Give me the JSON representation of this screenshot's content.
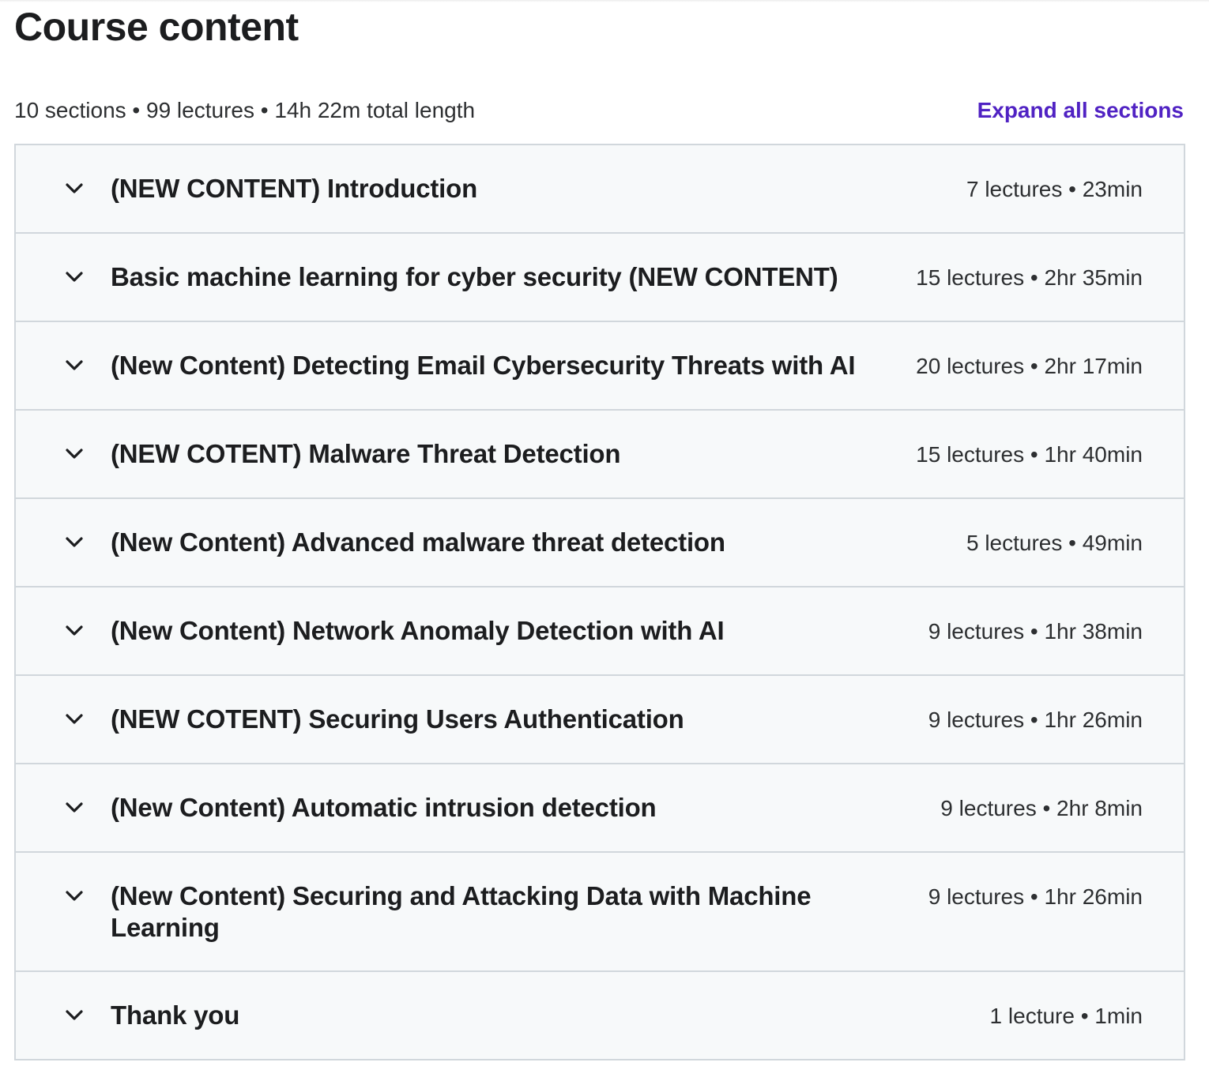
{
  "page": {
    "title": "Course content"
  },
  "summary": {
    "text": "10 sections • 99 lectures • 14h 22m total length",
    "expand_label": "Expand all sections"
  },
  "sections": [
    {
      "title": "(NEW CONTENT) Introduction",
      "meta": "7 lectures • 23min"
    },
    {
      "title": "Basic machine learning for cyber security (NEW CONTENT)",
      "meta": "15 lectures • 2hr 35min"
    },
    {
      "title": "(New Content) Detecting Email Cybersecurity Threats with AI",
      "meta": "20 lectures • 2hr 17min"
    },
    {
      "title": "(NEW COTENT) Malware Threat Detection",
      "meta": "15 lectures • 1hr 40min"
    },
    {
      "title": "(New Content) Advanced malware threat detection",
      "meta": "5 lectures • 49min"
    },
    {
      "title": "(New Content) Network Anomaly Detection with AI",
      "meta": "9 lectures • 1hr 38min"
    },
    {
      "title": "(NEW COTENT) Securing Users Authentication",
      "meta": "9 lectures • 1hr 26min"
    },
    {
      "title": "(New Content) Automatic intrusion detection",
      "meta": "9 lectures • 2hr 8min"
    },
    {
      "title": "(New Content) Securing and Attacking Data with Machine Learning",
      "meta": "9 lectures • 1hr 26min"
    },
    {
      "title": "Thank you",
      "meta": "1 lecture • 1min"
    }
  ],
  "icons": {
    "section_toggle": "chevron-down-icon"
  },
  "colors": {
    "link": "#5022c3",
    "section_bg": "#f7f9fa",
    "border": "#d1d7dc",
    "text": "#2d2f31"
  }
}
